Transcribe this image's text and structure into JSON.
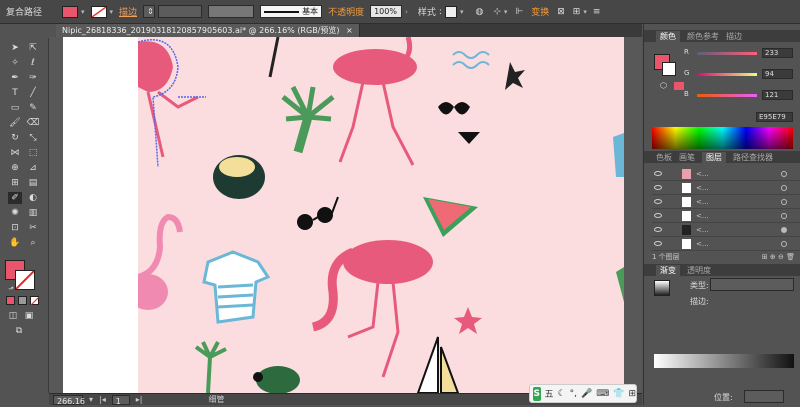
{
  "optbar": {
    "path_type": "复合路径",
    "stroke_label": "描边",
    "stroke_weight": "",
    "brush_label": "基本",
    "opacity_label": "不透明度",
    "opacity_value": "100%",
    "style_label": "样式",
    "transform_label": "变换"
  },
  "colors": {
    "fill": "#e8556c",
    "artboard_pink": "#fbdde0",
    "flamingo": "#e85a7b",
    "accent_orange": "#f49a3a"
  },
  "document": {
    "tab_title": "Nipic_26818336_20190318120857905603.ai* @ 266.16% (RGB/预览)"
  },
  "color_panel": {
    "tabs": [
      "颜色",
      "颜色参考",
      "描边"
    ],
    "r_label": "R",
    "g_label": "G",
    "b_label": "B",
    "r": "233",
    "g": "94",
    "b": "121",
    "hex": "E95E79"
  },
  "layers_panel": {
    "tabs": [
      "色板",
      "画笔",
      "图层",
      "路径查找器"
    ],
    "rows": [
      "<...",
      "<...",
      "<...",
      "<...",
      "<...",
      "<..."
    ],
    "footer": "1 个图层"
  },
  "gradient_panel": {
    "tabs": [
      "渐变",
      "透明度"
    ],
    "type_label": "类型:",
    "stroke_label": "描边:",
    "position_label": "位置:"
  },
  "statusbar": {
    "zoom": "266.16",
    "page": "1",
    "tool_name": "细管"
  },
  "ime": {
    "logo": "S",
    "text": "五"
  }
}
